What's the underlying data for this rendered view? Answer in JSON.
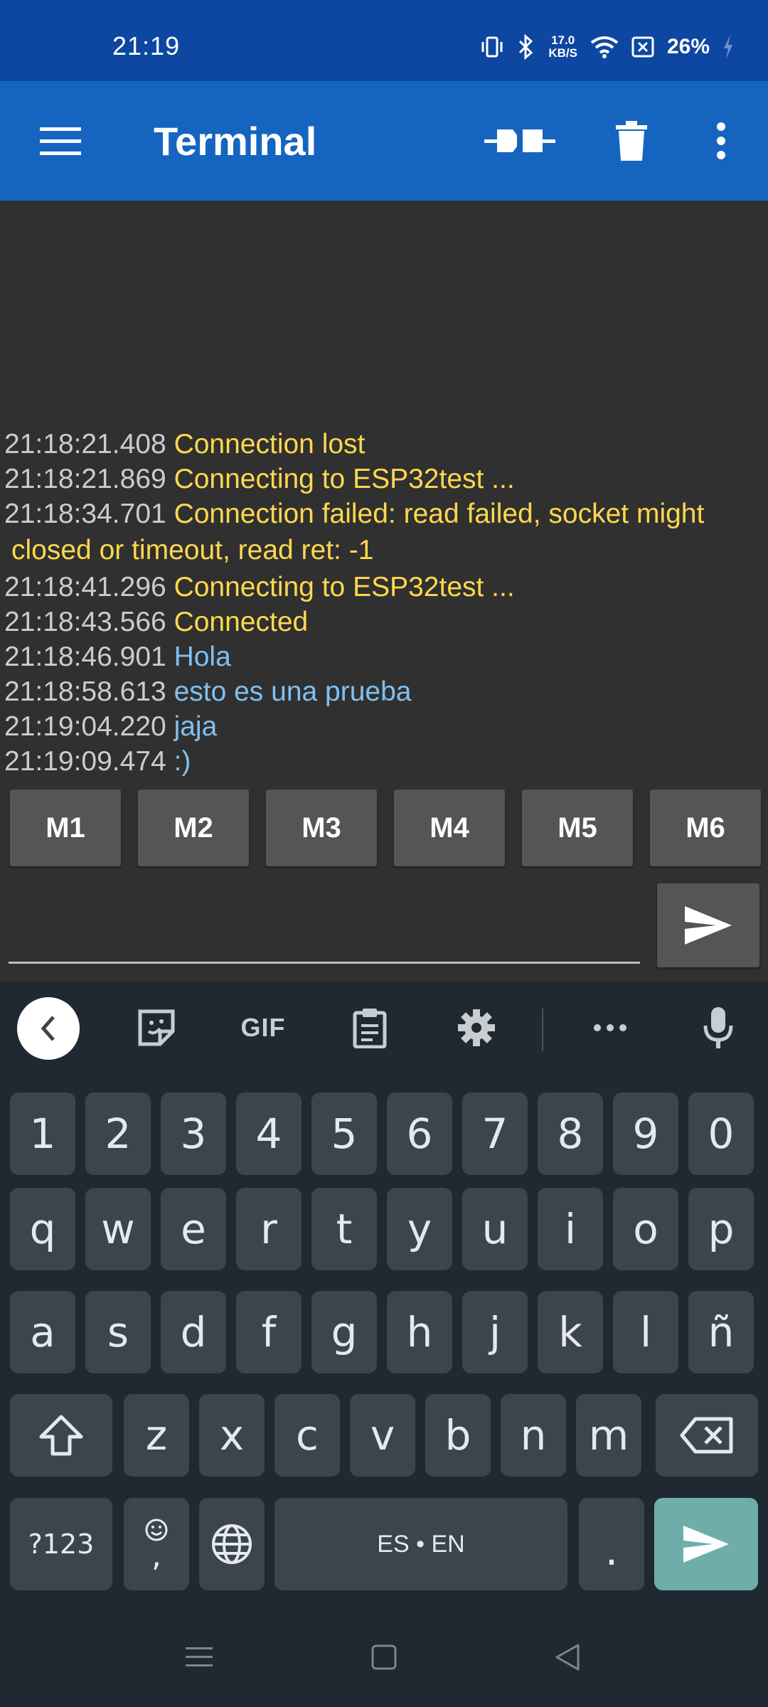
{
  "status_bar": {
    "time": "21:19",
    "net_speed_value": "17.0",
    "net_speed_unit": "KB/S",
    "battery": "26%"
  },
  "app_bar": {
    "title": "Terminal"
  },
  "terminal": {
    "lines": [
      {
        "time": "21:18:21.408",
        "text": "Connection lost",
        "kind": "status"
      },
      {
        "time": "21:18:21.869",
        "text": "Connecting to ESP32test ...",
        "kind": "status"
      },
      {
        "time": "21:18:34.701",
        "text": "Connection failed: read failed, socket might",
        "kind": "status"
      },
      {
        "time": "",
        "text": "closed or timeout, read ret: -1",
        "kind": "status"
      },
      {
        "time": "21:18:41.296",
        "text": "Connecting to ESP32test ...",
        "kind": "status"
      },
      {
        "time": "21:18:43.566",
        "text": "Connected",
        "kind": "status"
      },
      {
        "time": "21:18:46.901",
        "text": "Hola",
        "kind": "sent"
      },
      {
        "time": "21:18:58.613",
        "text": "esto es una prueba",
        "kind": "sent"
      },
      {
        "time": "21:19:04.220",
        "text": "jaja",
        "kind": "sent"
      },
      {
        "time": "21:19:09.474",
        "text": ":)",
        "kind": "sent"
      }
    ],
    "macros": [
      "M1",
      "M2",
      "M3",
      "M4",
      "M5",
      "M6"
    ],
    "input_value": ""
  },
  "keyboard": {
    "toolbar": {
      "gif_label": "GIF"
    },
    "number_row": [
      "1",
      "2",
      "3",
      "4",
      "5",
      "6",
      "7",
      "8",
      "9",
      "0"
    ],
    "row1": [
      "q",
      "w",
      "e",
      "r",
      "t",
      "y",
      "u",
      "i",
      "o",
      "p"
    ],
    "row2": [
      "a",
      "s",
      "d",
      "f",
      "g",
      "h",
      "j",
      "k",
      "l",
      "ñ"
    ],
    "row3": [
      "z",
      "x",
      "c",
      "v",
      "b",
      "n",
      "m"
    ],
    "symbols_label": "?123",
    "comma_label": ",",
    "space_label": "ES • EN",
    "period_label": "."
  },
  "colors": {
    "status_bar": "#0d47a1",
    "app_bar": "#1565c0",
    "terminal_bg": "#303030",
    "status_text": "#ffd84d",
    "sent_text": "#80c0f0",
    "timestamp_text": "#cccccc",
    "keyboard_bg": "#202931",
    "key_bg": "#3b454e",
    "enter_key": "#6fada8"
  }
}
